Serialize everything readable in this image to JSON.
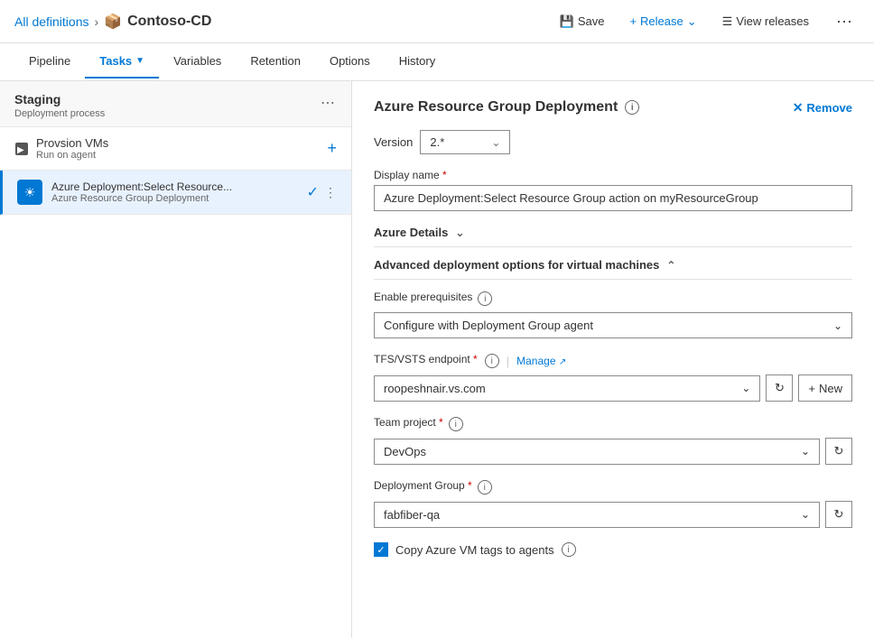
{
  "header": {
    "breadcrumb": "All definitions",
    "separator": ">",
    "title": "Contoso-CD",
    "save_label": "Save",
    "release_label": "Release",
    "view_releases_label": "View releases",
    "more_icon": "···"
  },
  "nav": {
    "tabs": [
      {
        "label": "Pipeline",
        "active": false
      },
      {
        "label": "Tasks",
        "active": true,
        "has_arrow": true
      },
      {
        "label": "Variables",
        "active": false
      },
      {
        "label": "Retention",
        "active": false
      },
      {
        "label": "Options",
        "active": false
      },
      {
        "label": "History",
        "active": false
      }
    ]
  },
  "left_panel": {
    "stage": {
      "title": "Staging",
      "subtitle": "Deployment process"
    },
    "phase": {
      "title": "Provsion VMs",
      "subtitle": "Run on agent"
    },
    "task": {
      "name": "Azure Deployment:Select Resource...",
      "subtitle": "Azure Resource Group Deployment"
    }
  },
  "right_panel": {
    "task_title": "Azure Resource Group Deployment",
    "remove_label": "Remove",
    "version_label": "Version",
    "version_value": "2.*",
    "display_name_label": "Display name",
    "display_name_value": "Azure Deployment:Select Resource Group action on myResourceGroup",
    "azure_details_label": "Azure Details",
    "advanced_label": "Advanced deployment options for virtual machines",
    "enable_prereq_label": "Enable prerequisites",
    "enable_prereq_value": "Configure with Deployment Group agent",
    "tfs_label": "TFS/VSTS endpoint",
    "manage_label": "Manage",
    "tfs_value": "roopeshnair.vs.com",
    "new_label": "New",
    "team_project_label": "Team project",
    "team_project_value": "DevOps",
    "deployment_group_label": "Deployment Group",
    "deployment_group_value": "fabfiber-qa",
    "copy_tags_label": "Copy Azure VM tags to agents"
  }
}
